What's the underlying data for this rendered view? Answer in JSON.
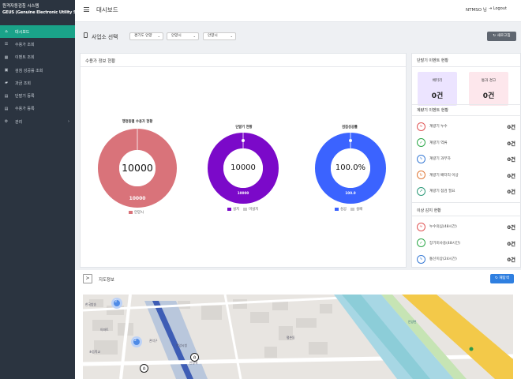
{
  "sidebar": {
    "brand_line1": "원격자동검침 시스템",
    "brand_line2": "GEUS (Genuine Electronic Utility Solution)",
    "items": [
      {
        "label": "대시보드",
        "icon": "home-icon",
        "active": true
      },
      {
        "label": "수용가 조회",
        "icon": "list-icon"
      },
      {
        "label": "이벤트 조회",
        "icon": "grid-icon"
      },
      {
        "label": "검침 성공률 조회",
        "icon": "calendar-icon"
      },
      {
        "label": "과금 조회",
        "icon": "truck-icon"
      },
      {
        "label": "단말기 등록",
        "icon": "file-icon"
      },
      {
        "label": "수용가 등록",
        "icon": "file-icon"
      },
      {
        "label": "관리",
        "icon": "settings-icon",
        "chevron": "›"
      }
    ]
  },
  "header": {
    "title": "대시보드",
    "user": "NTMSO 님",
    "logout": "Logout"
  },
  "filter": {
    "label": "사업소 선택",
    "selects": [
      "경기도 안양",
      "안양시",
      "안양시"
    ],
    "refresh": "새로고침"
  },
  "consumer_panel": {
    "title": "수용가 정보 현황",
    "donuts": [
      {
        "title": "행정동별 수용가 현황",
        "center": "10000",
        "inner": "10000",
        "color": "#d9737a",
        "legend": [
          {
            "label": "안양시",
            "color": "#d9737a"
          }
        ]
      },
      {
        "title": "단말기 현황",
        "center": "10000",
        "inner": "10000",
        "color": "#7b09c9",
        "legend": [
          {
            "label": "설치",
            "color": "#7b09c9"
          },
          {
            "label": "미설치",
            "color": "#c9c9c9"
          }
        ]
      },
      {
        "title": "검침성공률",
        "center": "100.0%",
        "inner": "100.0",
        "color": "#3b63ff",
        "legend": [
          {
            "label": "성공",
            "color": "#3b63ff"
          },
          {
            "label": "실패",
            "color": "#c9c9c9"
          }
        ]
      }
    ]
  },
  "terminal_panel": {
    "title": "단말기 이벤트 현황",
    "battery": {
      "label": "배터리",
      "value": "0건",
      "color": "#ece4ff"
    },
    "comm": {
      "label": "통과 경고",
      "value": "0건",
      "color": "#fde7ec"
    },
    "meter_events_title": "계량기 이벤트 현황",
    "meter_events": [
      {
        "label": "계량기 누수",
        "value": "0건",
        "icon": "leak-icon",
        "color": "#e05555",
        "glyph": "≈"
      },
      {
        "label": "계량기 역류",
        "value": "0건",
        "icon": "check-icon",
        "color": "#2ea84a",
        "glyph": "✓"
      },
      {
        "label": "계량기 과부하",
        "value": "0건",
        "icon": "overload-icon",
        "color": "#3a7bd5",
        "glyph": "∿"
      },
      {
        "label": "계량기 배터리 이상",
        "value": "0건",
        "icon": "battery-warning-icon",
        "color": "#e07a3a",
        "glyph": "↻"
      },
      {
        "label": "계량기 점검 필요",
        "value": "0건",
        "icon": "wrench-icon",
        "color": "#2e9a7a",
        "glyph": "➚"
      }
    ],
    "anomaly_title": "이상 감지 현황",
    "anomalies": [
      {
        "label": "누수의심(48시간)",
        "value": "0건",
        "icon": "leak-suspect-icon",
        "color": "#e05555",
        "glyph": "≈"
      },
      {
        "label": "장기미사용(48시간)",
        "value": "0건",
        "icon": "idle-icon",
        "color": "#2ea84a",
        "glyph": "✓"
      },
      {
        "label": "통신이상(24시간)",
        "value": "0건",
        "icon": "signal-icon",
        "color": "#3a7bd5",
        "glyph": "∿"
      }
    ]
  },
  "map": {
    "toggle": ">",
    "title": "지도정보",
    "button": "재탐색",
    "labels": [
      {
        "text": "한국방송"
      },
      {
        "text": "아파트"
      },
      {
        "text": "초등학교"
      },
      {
        "text": "관악구"
      },
      {
        "text": "안양시청"
      },
      {
        "text": "평촌동"
      },
      {
        "text": "안양역"
      },
      {
        "text": "안양천"
      }
    ],
    "clusters": [
      "3",
      "2"
    ]
  }
}
